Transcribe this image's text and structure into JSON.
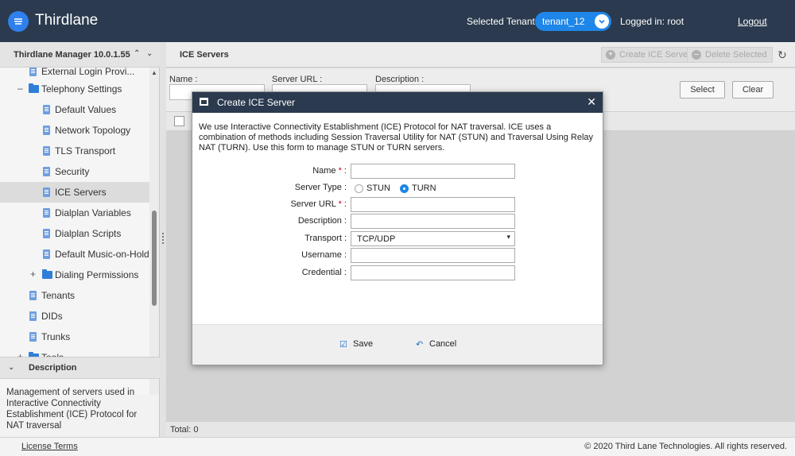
{
  "header": {
    "brand": "Thirdlane",
    "tenant_label": "Selected Tenant :",
    "tenant_value": "tenant_12",
    "logged_in": "Logged in: root",
    "logout": "Logout"
  },
  "left_pane": {
    "title": "Thirdlane Manager 10.0.1.55",
    "tree": [
      {
        "label": "External Login Provi...",
        "type": "doc",
        "level": 1
      },
      {
        "label": "Telephony Settings",
        "type": "folder",
        "level": 1,
        "expander": "–"
      },
      {
        "label": "Default Values",
        "type": "doc",
        "level": 2
      },
      {
        "label": "Network Topology",
        "type": "doc",
        "level": 2
      },
      {
        "label": "TLS Transport",
        "type": "doc",
        "level": 2
      },
      {
        "label": "Security",
        "type": "doc",
        "level": 2
      },
      {
        "label": "ICE Servers",
        "type": "doc",
        "level": 2,
        "selected": true
      },
      {
        "label": "Dialplan Variables",
        "type": "doc",
        "level": 2
      },
      {
        "label": "Dialplan Scripts",
        "type": "doc",
        "level": 2
      },
      {
        "label": "Default Music-on-Hold",
        "type": "doc",
        "level": 2
      },
      {
        "label": "Dialing Permissions",
        "type": "folder",
        "level": 2,
        "expander": "+"
      },
      {
        "label": "Tenants",
        "type": "doc",
        "level": 1
      },
      {
        "label": "DIDs",
        "type": "doc",
        "level": 1
      },
      {
        "label": "Trunks",
        "type": "doc",
        "level": 1
      },
      {
        "label": "Tools",
        "type": "folder",
        "level": 1,
        "expander": "+"
      }
    ],
    "description_title": "Description",
    "description_text": "Management of servers used in Interactive Connectivity Establishment (ICE) Protocol for NAT traversal"
  },
  "right_pane": {
    "title": "ICE Servers",
    "create_button": "Create ICE Server",
    "delete_button": "Delete Selected",
    "filters": {
      "name_label": "Name :",
      "server_url_label": "Server URL :",
      "description_label": "Description :",
      "select_button": "Select",
      "clear_button": "Clear"
    },
    "total": "Total: 0"
  },
  "footer": {
    "license": "License Terms",
    "copyright": "© 2020 Third Lane Technologies. All rights reserved."
  },
  "modal": {
    "title": "Create ICE Server",
    "intro": "We use Interactive Connectivity Establishment (ICE) Protocol for NAT traversal. ICE uses a combination of methods including Session Traversal Utility for NAT (STUN) and Traversal Using Relay NAT (TURN). Use this form to manage STUN or TURN servers.",
    "fields": {
      "name": {
        "label": "Name",
        "required": true,
        "value": ""
      },
      "server_type": {
        "label": "Server Type :",
        "options": [
          "STUN",
          "TURN"
        ],
        "selected": "TURN"
      },
      "server_url": {
        "label": "Server URL",
        "required": true,
        "value": ""
      },
      "description": {
        "label": "Description :",
        "value": ""
      },
      "transport": {
        "label": "Transport :",
        "value": "TCP/UDP"
      },
      "username": {
        "label": "Username :",
        "value": ""
      },
      "credential": {
        "label": "Credential :",
        "value": ""
      }
    },
    "save_button": "Save",
    "cancel_button": "Cancel"
  },
  "colors": {
    "topbar": "#2b3a4e",
    "accent": "#1e86e8",
    "required": "#d0021b"
  }
}
